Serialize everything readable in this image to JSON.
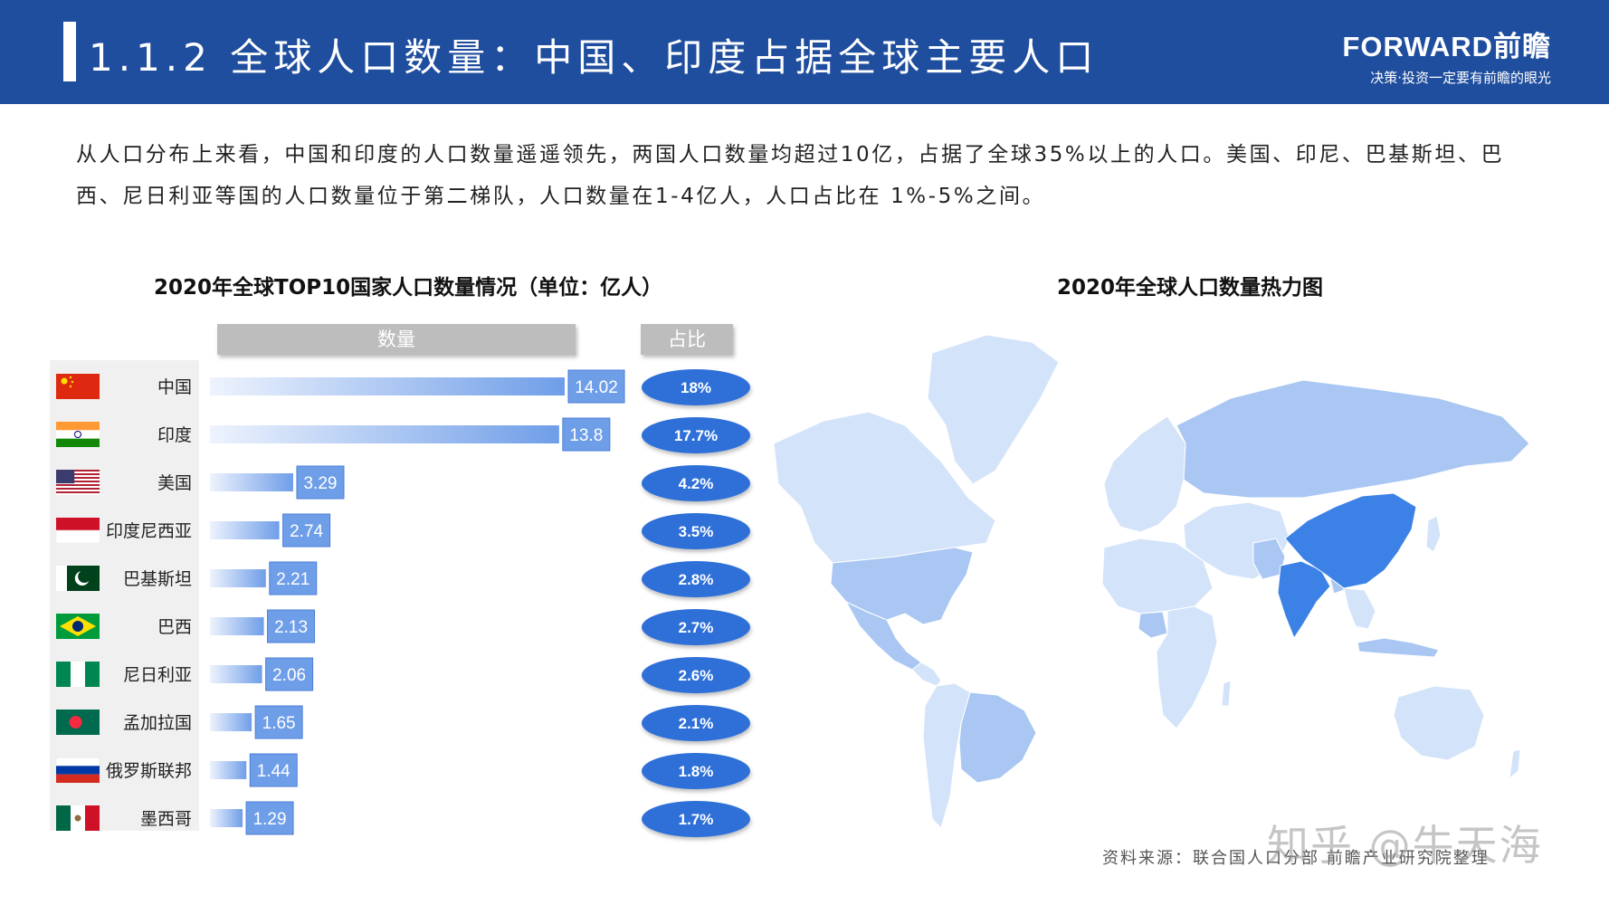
{
  "header": {
    "title": "1.1.2 全球人口数量：中国、印度占据全球主要人口",
    "brand_name": "FORWARD前瞻",
    "brand_slogan": "决策·投资一定要有前瞻的眼光"
  },
  "intro": "从人口分布上来看，中国和印度的人口数量遥遥领先，两国人口数量均超过10亿，占据了全球35%以上的人口。美国、印尼、巴基斯坦、巴西、尼日利亚等国的人口数量位于第二梯队，人口数量在1-4亿人，人口占比在 1%-5%之间。",
  "source": "资料来源：联合国人口分部 前瞻产业研究院整理",
  "watermark": "知乎 @牛天海",
  "colors": {
    "header_bg": "#1f4e9e",
    "bar_end": "#6f9ee8",
    "bar_start": "#eef3fd",
    "label_box": "#6f9ee8",
    "pct_ellipse": "#2e6fd8",
    "map_high": "#3c82e6",
    "map_mid": "#a9c7f2",
    "map_low": "#d3e3f9"
  },
  "chart_data": [
    {
      "type": "bar",
      "title": "2020年全球TOP10国家人口数量情况（单位：亿人）",
      "column_headers": {
        "count": "数量",
        "share": "占比"
      },
      "categories": [
        "中国",
        "印度",
        "美国",
        "印度尼西亚",
        "巴基斯坦",
        "巴西",
        "尼日利亚",
        "孟加拉国",
        "俄罗斯联邦",
        "墨西哥"
      ],
      "values": [
        14.02,
        13.8,
        3.29,
        2.74,
        2.21,
        2.13,
        2.06,
        1.65,
        1.44,
        1.29
      ],
      "value_labels": [
        "14.02",
        "13.8",
        "3.29",
        "2.74",
        "2.21",
        "2.13",
        "2.06",
        "1.65",
        "1.44",
        "1.29"
      ],
      "shares": [
        "18%",
        "17.7%",
        "4.2%",
        "3.5%",
        "2.8%",
        "2.7%",
        "2.6%",
        "2.1%",
        "1.8%",
        "1.7%"
      ],
      "flags": [
        "china-flag",
        "india-flag",
        "usa-flag",
        "indonesia-flag",
        "pakistan-flag",
        "brazil-flag",
        "nigeria-flag",
        "bangladesh-flag",
        "russia-flag",
        "mexico-flag"
      ],
      "orientation": "horizontal",
      "xlim": [
        0,
        14.02
      ],
      "grid": false,
      "legend": "none"
    },
    {
      "type": "heatmap",
      "title": "2020年全球人口数量热力图",
      "highlighted_regions": [
        "China",
        "India"
      ],
      "medium_regions": [
        "USA",
        "Indonesia",
        "Pakistan",
        "Brazil",
        "Nigeria",
        "Bangladesh",
        "Russia",
        "Mexico"
      ]
    }
  ]
}
